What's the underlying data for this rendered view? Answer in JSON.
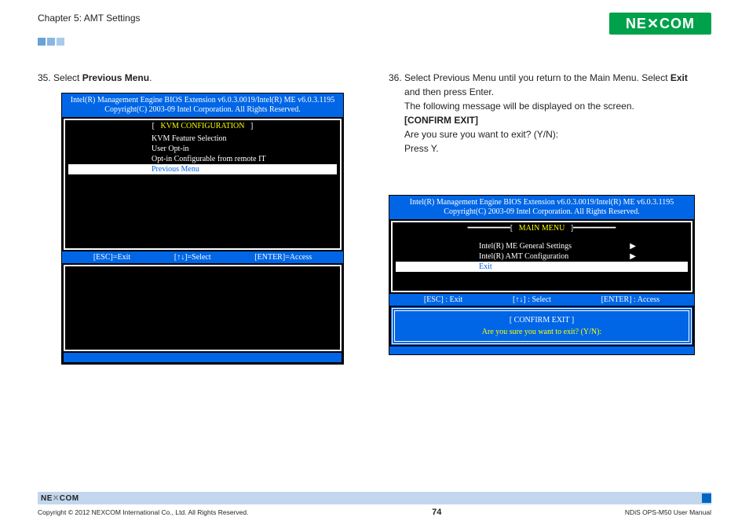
{
  "header": {
    "chapter": "Chapter 5: AMT Settings",
    "logo_text": "NEXCOM"
  },
  "left": {
    "step_num": "35.",
    "step_text_a": "Select ",
    "step_bold": "Previous Menu",
    "step_text_b": ".",
    "bios": {
      "hdr1": "Intel(R) Management Engine BIOS Extension v6.0.3.0019/Intel(R) ME v6.0.3.1195",
      "hdr2": "Copyright(C) 2003-09 Intel Corporation. All Rights Reserved.",
      "title": "KVM CONFIGURATION",
      "items": [
        "KVM Feature Selection",
        "User Opt-in",
        "Opt-in Configurable from remote IT",
        "Previous Menu"
      ],
      "nav": {
        "esc": "[ESC]=Exit",
        "sel": "[↑↓]=Select",
        "ent": "[ENTER]=Access"
      }
    }
  },
  "right": {
    "step_num": "36.",
    "line1a": "Select Previous Menu until you return to the Main Menu. Select ",
    "line1bold": "Exit",
    "line2": "and then press Enter.",
    "line3": "The following message will be displayed on the screen.",
    "line4bold": "[CONFIRM EXIT]",
    "line5": "Are you sure you want to exit? (Y/N):",
    "line6": "Press Y.",
    "bios": {
      "hdr1": "Intel(R) Management Engine BIOS Extension v6.0.3.0019/Intel(R) ME v6.0.3.1195",
      "hdr2": "Copyright(C) 2003-09 Intel Corporation. All Rights Reserved.",
      "title": "MAIN MENU",
      "items": [
        "Intel(R) ME General Settings",
        "Intel(R) AMT Configuration",
        "Exit"
      ],
      "arrow": "▶",
      "nav": {
        "esc": "[ESC] : Exit",
        "sel": "[↑↓] : Select",
        "ent": "[ENTER] : Access"
      },
      "confirm_title": "[ CONFIRM EXIT ]",
      "confirm_msg": "Are you sure you want to exit? (Y/N):"
    }
  },
  "footer": {
    "copyright": "Copyright © 2012 NEXCOM International Co., Ltd. All Rights Reserved.",
    "page": "74",
    "manual": "NDiS OPS-M50 User Manual"
  }
}
